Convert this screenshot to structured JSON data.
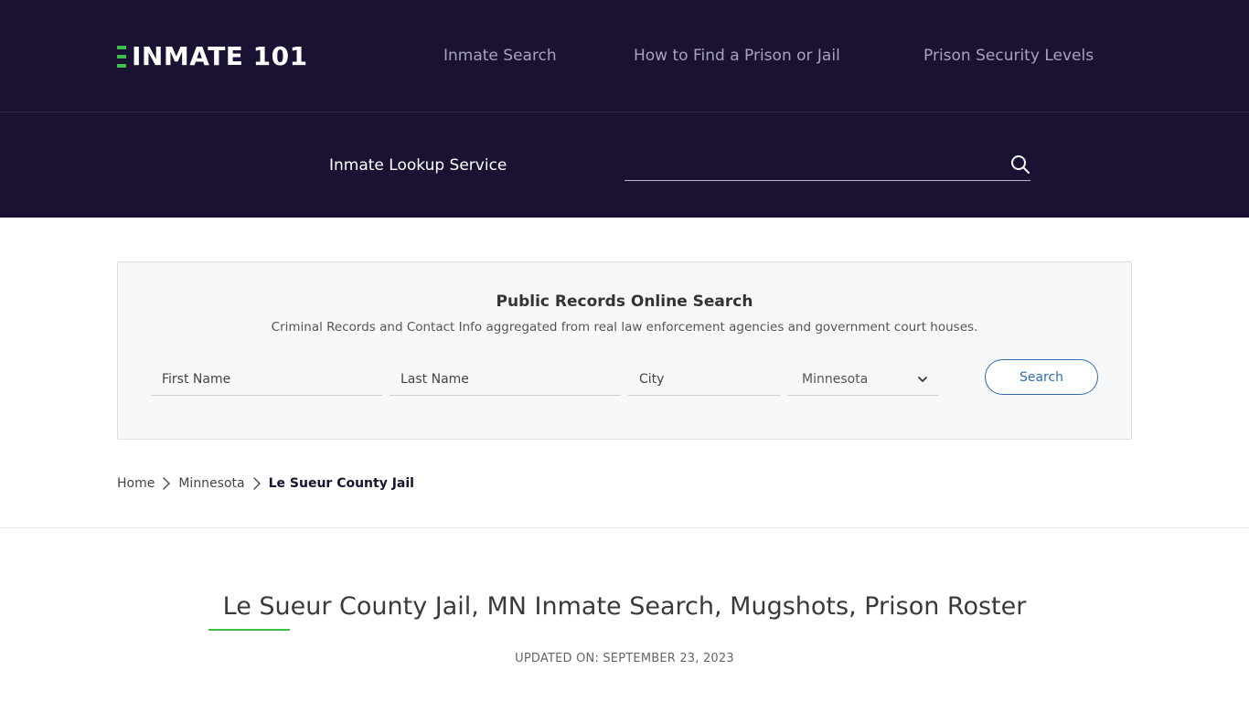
{
  "header": {
    "logo_text": "INMATE 101",
    "nav": [
      {
        "label": "Inmate Search"
      },
      {
        "label": "How to Find a Prison or Jail"
      },
      {
        "label": "Prison Security Levels"
      }
    ]
  },
  "lookup": {
    "label": "Inmate Lookup Service",
    "value": "",
    "icon": "search-icon"
  },
  "records_search": {
    "title": "Public Records Online Search",
    "subtitle": "Criminal Records and Contact Info aggregated from real law enforcement agencies and government court houses.",
    "first_name_placeholder": "First Name",
    "last_name_placeholder": "Last Name",
    "city_placeholder": "City",
    "state_selected": "Minnesota",
    "search_label": "Search"
  },
  "breadcrumb": {
    "items": [
      "Home",
      "Minnesota"
    ],
    "current": "Le Sueur County Jail"
  },
  "page": {
    "title": "Le Sueur County Jail, MN Inmate Search, Mugshots, Prison Roster",
    "updated": "UPDATED ON: SEPTEMBER 23, 2023"
  },
  "colors": {
    "header_bg": "#1b1133",
    "accent_green": "#3cc04a",
    "button_blue": "#2f6db0"
  }
}
